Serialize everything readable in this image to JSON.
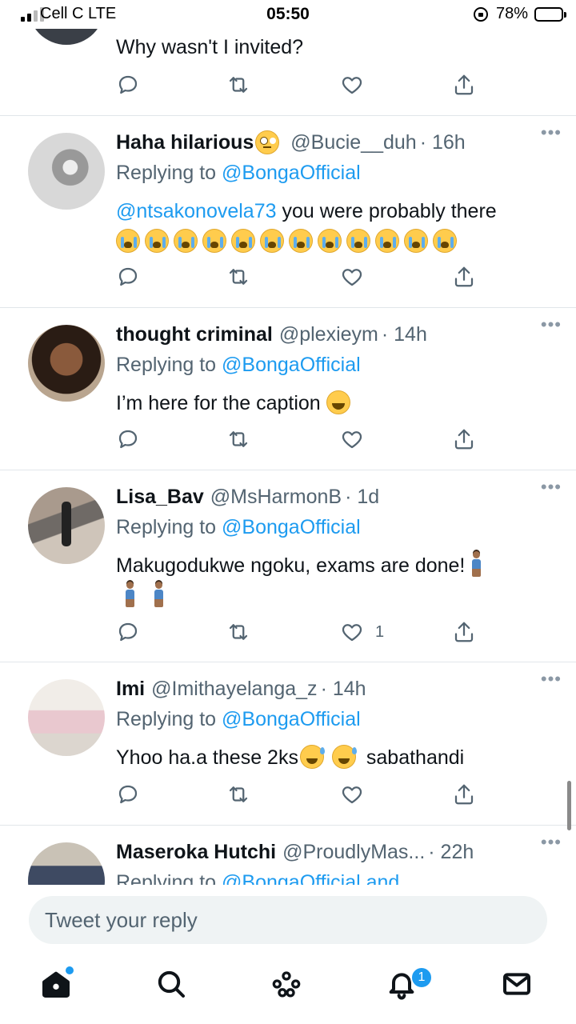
{
  "status_bar": {
    "carrier": "Cell C  LTE",
    "time": "05:50",
    "battery": "78%",
    "battery_level": 0.78
  },
  "tweets": [
    {
      "text": "Why wasn't I invited?",
      "likes": ""
    },
    {
      "name": "Haha hilarious",
      "name_emoji": "face-with-rolling-eyes",
      "handle": "@Bucie__duh",
      "time": "· 16h",
      "replying_prefix": "Replying to ",
      "replying_to": "@BongaOfficial",
      "mention": "@ntsakonovela73",
      "text": " you were probably there",
      "emoji_line": [
        "loudly-crying-face",
        "loudly-crying-face",
        "loudly-crying-face",
        "loudly-crying-face",
        "loudly-crying-face",
        "loudly-crying-face",
        "loudly-crying-face",
        "loudly-crying-face",
        "loudly-crying-face",
        "loudly-crying-face",
        "loudly-crying-face",
        "loudly-crying-face"
      ],
      "likes": ""
    },
    {
      "name": "thought criminal",
      "handle": "@plexieym",
      "time": "· 14h",
      "replying_prefix": "Replying to ",
      "replying_to": "@BongaOfficial",
      "text": "I’m here for the caption ",
      "text_emoji": "rolling-on-the-floor-laughing",
      "likes": ""
    },
    {
      "name": "Lisa_Bav",
      "handle": "@MsHarmonB",
      "time": "· 1d",
      "replying_prefix": "Replying to ",
      "replying_to": "@BongaOfficial",
      "text": "Makugodukwe ngoku, exams are done! ",
      "text_emoji": "person-standing",
      "likes": "1"
    },
    {
      "name": "Imi",
      "handle": "@Imithayelanga_z",
      "time": "· 14h",
      "replying_prefix": "Replying to ",
      "replying_to": "@BongaOfficial",
      "text_a": "Yhoo ha.a these 2ks",
      "text_b": " sabathandi",
      "text_emoji": "grinning-face-with-sweat",
      "likes": ""
    },
    {
      "name": "Maseroka Hutchi",
      "handle": "@ProudlyMas...",
      "time": " · 22h",
      "replying_prefix": "Replying to ",
      "replying_to": "@BongaOfficial and"
    }
  ],
  "reply": {
    "placeholder": "Tweet your reply"
  },
  "tabbar": {
    "icons": [
      "home-icon",
      "search-icon",
      "spaces-icon",
      "notifications-icon",
      "messages-icon"
    ],
    "notifications_count": "1"
  },
  "colors": {
    "accent": "#1d9bf0",
    "text": "#0f1419",
    "secondary": "#536471",
    "divider": "#e1e6ea"
  }
}
